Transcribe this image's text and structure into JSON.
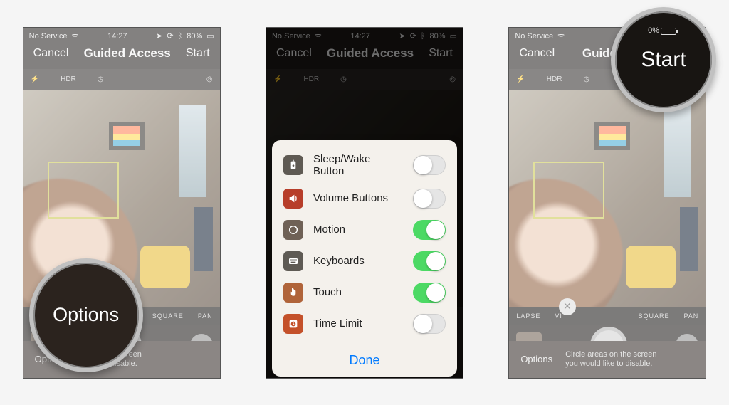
{
  "status": {
    "carrier": "No Service",
    "time": "14:27",
    "battery_pct": "80%",
    "battery_pct_zoom": "0%"
  },
  "nav": {
    "cancel": "Cancel",
    "title": "Guided Access",
    "title_clipped": "Guided Acces",
    "start": "Start"
  },
  "cam": {
    "hdr": "HDR",
    "mode_lapse": "LAPSE",
    "mode_video": "VI",
    "mode_square": "SQUARE",
    "mode_pano": "PAN"
  },
  "footer": {
    "options": "Options",
    "hint_line1": "Circle areas on the screen",
    "hint_line2": "you would like to disable.",
    "hint_line1_clipped": "eas on the screen",
    "hint_line2_clipped": "ld like to disable."
  },
  "sheet": {
    "icons": {
      "sleep": "#5f5a53",
      "volume": "#b73e2a",
      "motion": "#6f6156",
      "keyboard": "#5e5a54",
      "touch": "#b0643a",
      "time": "#c4512a"
    },
    "options": [
      {
        "label": "Sleep/Wake Button",
        "on": false
      },
      {
        "label": "Volume Buttons",
        "on": false
      },
      {
        "label": "Motion",
        "on": true
      },
      {
        "label": "Keyboards",
        "on": true
      },
      {
        "label": "Touch",
        "on": true
      },
      {
        "label": "Time Limit",
        "on": false
      }
    ],
    "done": "Done"
  }
}
